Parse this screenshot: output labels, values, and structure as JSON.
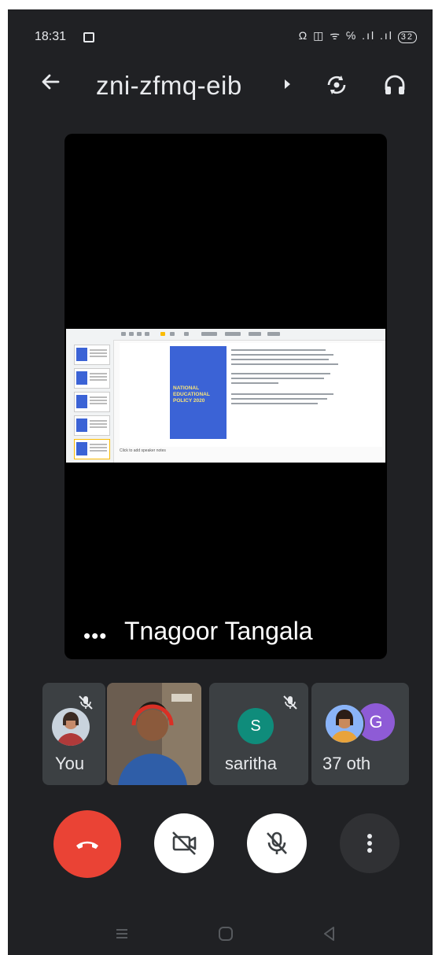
{
  "status_bar": {
    "time": "18:31",
    "signal_icons": "Ω ◫ ᯤ ℅ .ıl .ıl",
    "battery": "32"
  },
  "header": {
    "meeting_code": "zni-zfmq-eib"
  },
  "main_video": {
    "speaker_name": "Tnagoor Tangala",
    "more_label": "•••",
    "shared_slide": {
      "cover_title": "NATIONAL EDUCATIONAL POLICY 2020",
      "notes_text": "Click to add speaker notes"
    }
  },
  "participants": [
    {
      "label": "You",
      "mic_muted": true
    },
    {
      "label": "",
      "camera_on": true
    },
    {
      "label": "saritha",
      "initial": "S",
      "mic_muted": true,
      "avatar_color": "#0f8c7b"
    },
    {
      "label": "37 oth",
      "initial": "G",
      "avatar_color": "#8e5bd6"
    }
  ],
  "controls": {
    "end_call_color": "#ea4335",
    "camera": "camera-off",
    "microphone": "mic-off",
    "more": "more-options"
  },
  "icons": [
    "back-arrow-icon",
    "switch-camera-icon",
    "headphones-icon",
    "mic-off-icon",
    "phone-hangup-icon",
    "camera-off-icon",
    "more-vert-icon",
    "nav-recents-icon",
    "nav-home-icon",
    "nav-back-icon"
  ]
}
